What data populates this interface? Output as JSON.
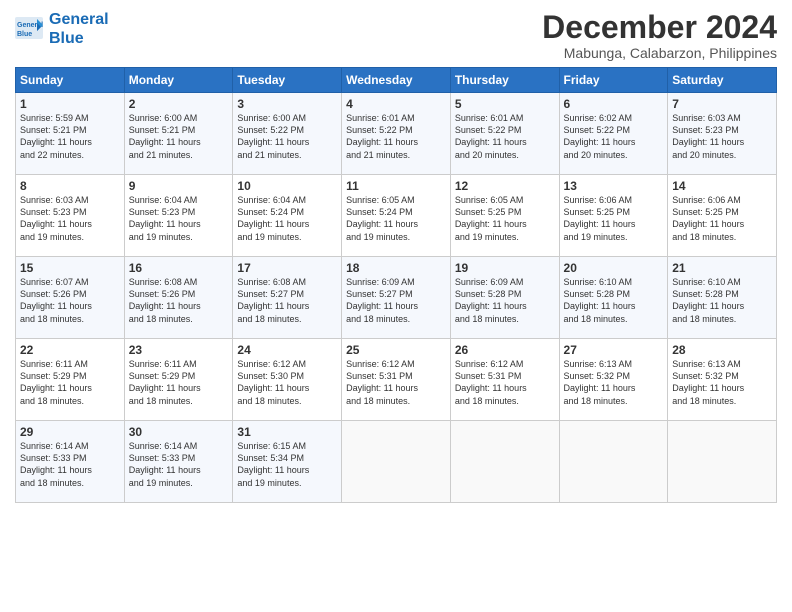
{
  "logo": {
    "line1": "General",
    "line2": "Blue"
  },
  "title": "December 2024",
  "location": "Mabunga, Calabarzon, Philippines",
  "headers": [
    "Sunday",
    "Monday",
    "Tuesday",
    "Wednesday",
    "Thursday",
    "Friday",
    "Saturday"
  ],
  "weeks": [
    [
      {
        "day": "1",
        "sunrise": "5:59 AM",
        "sunset": "5:21 PM",
        "daylight": "11 hours and 22 minutes."
      },
      {
        "day": "2",
        "sunrise": "6:00 AM",
        "sunset": "5:21 PM",
        "daylight": "11 hours and 21 minutes."
      },
      {
        "day": "3",
        "sunrise": "6:00 AM",
        "sunset": "5:22 PM",
        "daylight": "11 hours and 21 minutes."
      },
      {
        "day": "4",
        "sunrise": "6:01 AM",
        "sunset": "5:22 PM",
        "daylight": "11 hours and 21 minutes."
      },
      {
        "day": "5",
        "sunrise": "6:01 AM",
        "sunset": "5:22 PM",
        "daylight": "11 hours and 20 minutes."
      },
      {
        "day": "6",
        "sunrise": "6:02 AM",
        "sunset": "5:22 PM",
        "daylight": "11 hours and 20 minutes."
      },
      {
        "day": "7",
        "sunrise": "6:03 AM",
        "sunset": "5:23 PM",
        "daylight": "11 hours and 20 minutes."
      }
    ],
    [
      {
        "day": "8",
        "sunrise": "6:03 AM",
        "sunset": "5:23 PM",
        "daylight": "11 hours and 19 minutes."
      },
      {
        "day": "9",
        "sunrise": "6:04 AM",
        "sunset": "5:23 PM",
        "daylight": "11 hours and 19 minutes."
      },
      {
        "day": "10",
        "sunrise": "6:04 AM",
        "sunset": "5:24 PM",
        "daylight": "11 hours and 19 minutes."
      },
      {
        "day": "11",
        "sunrise": "6:05 AM",
        "sunset": "5:24 PM",
        "daylight": "11 hours and 19 minutes."
      },
      {
        "day": "12",
        "sunrise": "6:05 AM",
        "sunset": "5:25 PM",
        "daylight": "11 hours and 19 minutes."
      },
      {
        "day": "13",
        "sunrise": "6:06 AM",
        "sunset": "5:25 PM",
        "daylight": "11 hours and 19 minutes."
      },
      {
        "day": "14",
        "sunrise": "6:06 AM",
        "sunset": "5:25 PM",
        "daylight": "11 hours and 18 minutes."
      }
    ],
    [
      {
        "day": "15",
        "sunrise": "6:07 AM",
        "sunset": "5:26 PM",
        "daylight": "11 hours and 18 minutes."
      },
      {
        "day": "16",
        "sunrise": "6:08 AM",
        "sunset": "5:26 PM",
        "daylight": "11 hours and 18 minutes."
      },
      {
        "day": "17",
        "sunrise": "6:08 AM",
        "sunset": "5:27 PM",
        "daylight": "11 hours and 18 minutes."
      },
      {
        "day": "18",
        "sunrise": "6:09 AM",
        "sunset": "5:27 PM",
        "daylight": "11 hours and 18 minutes."
      },
      {
        "day": "19",
        "sunrise": "6:09 AM",
        "sunset": "5:28 PM",
        "daylight": "11 hours and 18 minutes."
      },
      {
        "day": "20",
        "sunrise": "6:10 AM",
        "sunset": "5:28 PM",
        "daylight": "11 hours and 18 minutes."
      },
      {
        "day": "21",
        "sunrise": "6:10 AM",
        "sunset": "5:28 PM",
        "daylight": "11 hours and 18 minutes."
      }
    ],
    [
      {
        "day": "22",
        "sunrise": "6:11 AM",
        "sunset": "5:29 PM",
        "daylight": "11 hours and 18 minutes."
      },
      {
        "day": "23",
        "sunrise": "6:11 AM",
        "sunset": "5:29 PM",
        "daylight": "11 hours and 18 minutes."
      },
      {
        "day": "24",
        "sunrise": "6:12 AM",
        "sunset": "5:30 PM",
        "daylight": "11 hours and 18 minutes."
      },
      {
        "day": "25",
        "sunrise": "6:12 AM",
        "sunset": "5:31 PM",
        "daylight": "11 hours and 18 minutes."
      },
      {
        "day": "26",
        "sunrise": "6:12 AM",
        "sunset": "5:31 PM",
        "daylight": "11 hours and 18 minutes."
      },
      {
        "day": "27",
        "sunrise": "6:13 AM",
        "sunset": "5:32 PM",
        "daylight": "11 hours and 18 minutes."
      },
      {
        "day": "28",
        "sunrise": "6:13 AM",
        "sunset": "5:32 PM",
        "daylight": "11 hours and 18 minutes."
      }
    ],
    [
      {
        "day": "29",
        "sunrise": "6:14 AM",
        "sunset": "5:33 PM",
        "daylight": "11 hours and 18 minutes."
      },
      {
        "day": "30",
        "sunrise": "6:14 AM",
        "sunset": "5:33 PM",
        "daylight": "11 hours and 19 minutes."
      },
      {
        "day": "31",
        "sunrise": "6:15 AM",
        "sunset": "5:34 PM",
        "daylight": "11 hours and 19 minutes."
      },
      null,
      null,
      null,
      null
    ]
  ]
}
